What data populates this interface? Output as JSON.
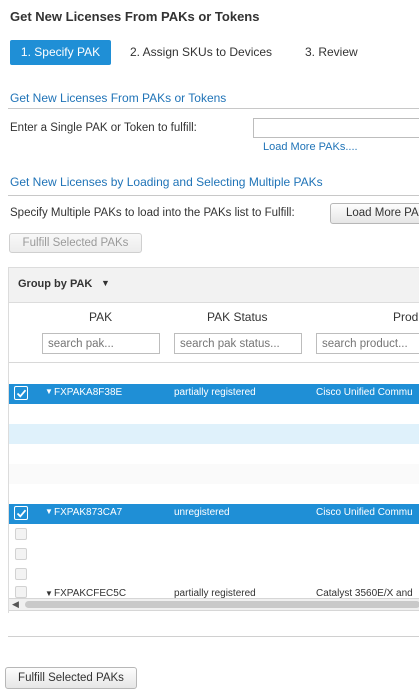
{
  "header": {
    "title": "Get New Licenses From PAKs or Tokens"
  },
  "steps": [
    {
      "label": "1. Specify PAK",
      "active": true
    },
    {
      "label": "2. Assign SKUs to Devices",
      "active": false
    },
    {
      "label": "3. Review",
      "active": false
    }
  ],
  "single": {
    "heading": "Get New Licenses From PAKs or Tokens",
    "prompt": "Enter a Single PAK or Token to fulfill:",
    "input_value": "",
    "load_more_link": "Load More PAKs...."
  },
  "multiple": {
    "heading": "Get New Licenses by Loading and Selecting Multiple PAKs",
    "prompt": "Specify Multiple PAKs to load into the PAKs list to Fulfill:",
    "load_more_button": "Load More PA",
    "fulfill_button": "Fulfill Selected PAKs"
  },
  "grid": {
    "group_by": "Group by PAK",
    "columns": [
      {
        "header": "PAK",
        "placeholder": "search pak..."
      },
      {
        "header": "PAK Status",
        "placeholder": "search pak status..."
      },
      {
        "header": "Prod",
        "placeholder": "search product..."
      }
    ],
    "rows": [
      {
        "type": "group",
        "selected": true,
        "pak": "FXPAKA8F38E",
        "status": "partially registered",
        "product": "Cisco Unified Commu"
      },
      {
        "type": "blank",
        "style": "alt"
      },
      {
        "type": "blank",
        "style": "plain"
      },
      {
        "type": "group",
        "selected": true,
        "pak": "FXPAK873CA7",
        "status": "unregistered",
        "product": "Cisco Unified Commu"
      },
      {
        "type": "child"
      },
      {
        "type": "child"
      },
      {
        "type": "child"
      },
      {
        "type": "group",
        "selected": false,
        "pak": "FXPAKCFEC5C",
        "status": "partially registered",
        "product": "Catalyst 3560E/X and"
      }
    ]
  },
  "footer": {
    "fulfill_button": "Fulfill Selected PAKs"
  },
  "colors": {
    "accent": "#1f8fd6",
    "link": "#1f73b7",
    "row_alt": "#dff1fb"
  }
}
